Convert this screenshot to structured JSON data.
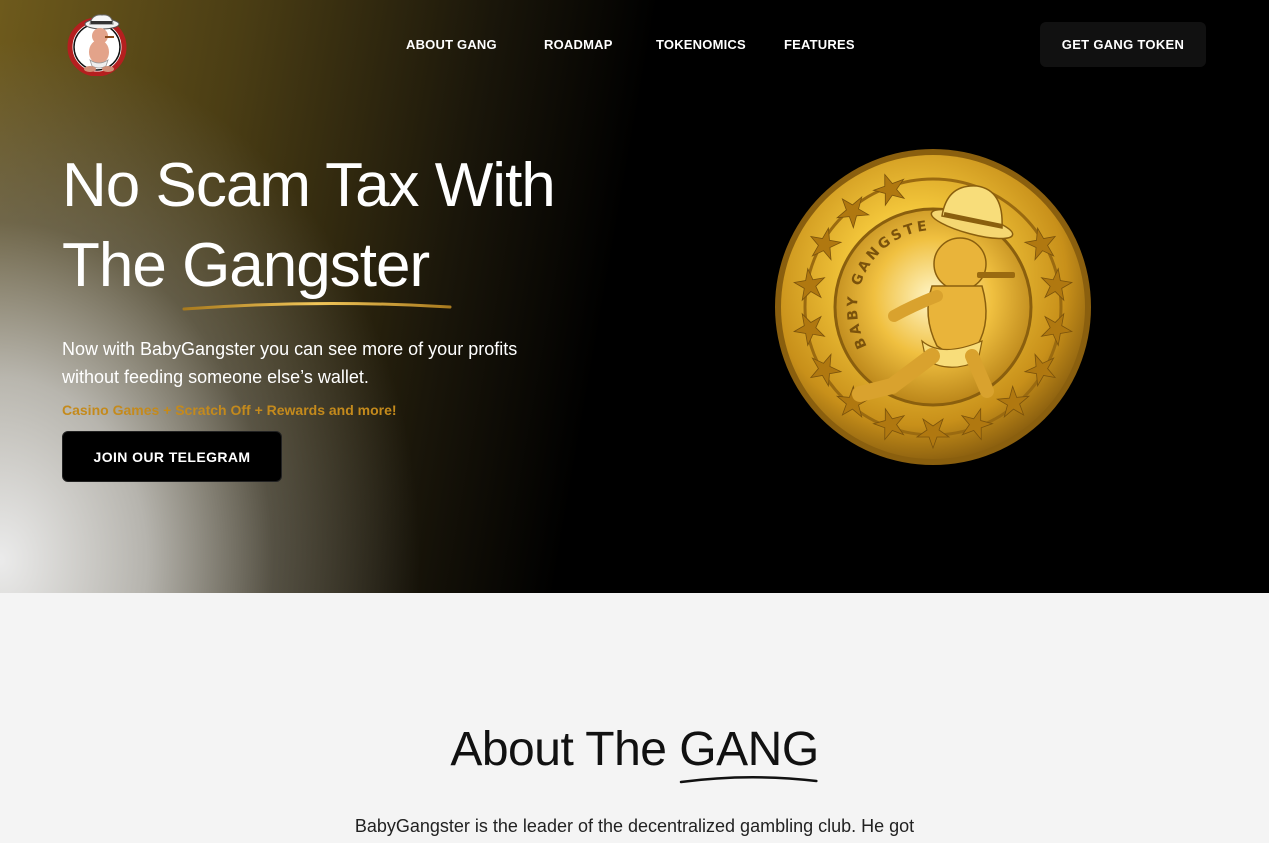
{
  "header": {
    "logo_icon": "baby-gangster-logo-icon",
    "nav": [
      {
        "label": "ABOUT GANG"
      },
      {
        "label": "ROADMAP"
      },
      {
        "label": "TOKENOMICS"
      },
      {
        "label": "FEATURES"
      }
    ],
    "cta_label": "GET GANG TOKEN"
  },
  "hero": {
    "headline_line1": "No Scam Tax With",
    "headline_line2_prefix": "The ",
    "headline_accent": "Gangster",
    "lead": "Now with BabyGangster you can see more of your profits without feeding someone else’s wallet.",
    "tagline": "Casino Games + Scratch Off + Rewards and more!",
    "telegram_button": "JOIN OUR TELEGRAM",
    "coin_text": "BABY GANGSTER",
    "coin_icon": "gold-coin-icon"
  },
  "about": {
    "title_prefix": "About The ",
    "title_accent": "GANG",
    "text": "BabyGangster is the leader of the decentralized gambling club. He got"
  },
  "colors": {
    "accent_gold": "#c48a1c",
    "hero_bg": "#000000",
    "page_bg": "#f4f4f4"
  }
}
